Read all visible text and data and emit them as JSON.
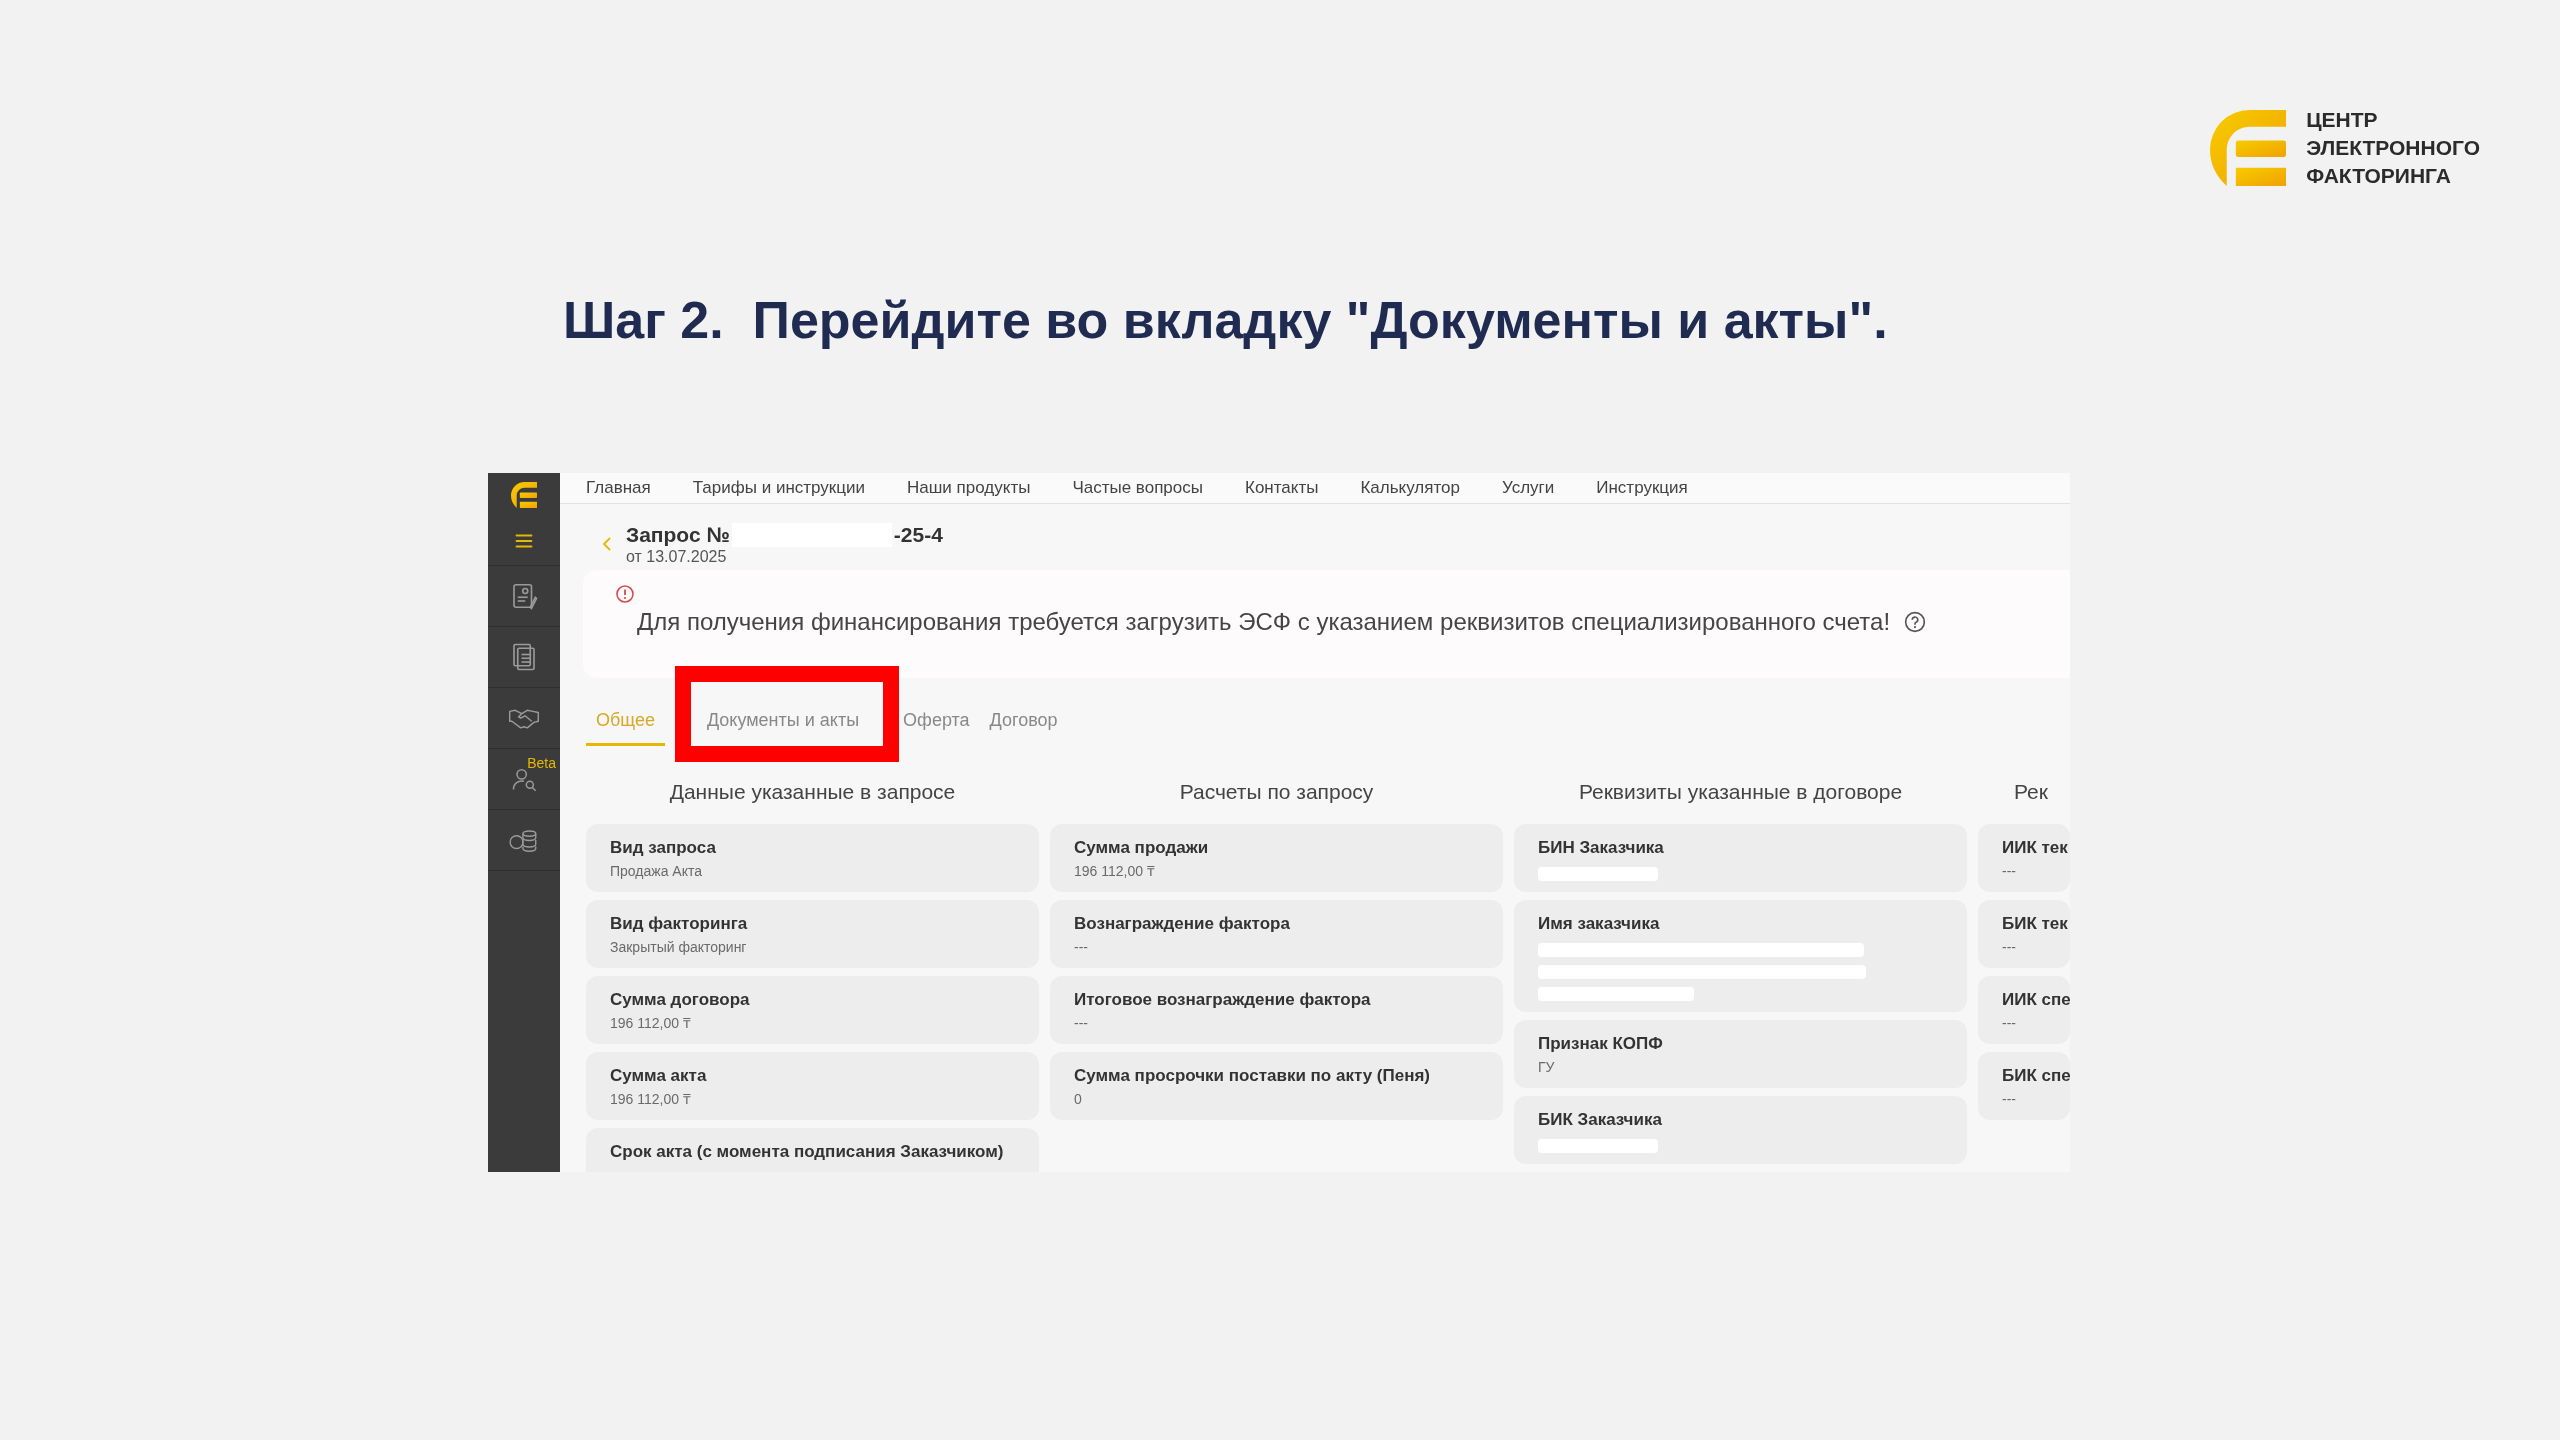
{
  "brand": {
    "lines": [
      "ЦЕНТР",
      "ЭЛЕКТРОННОГО",
      "ФАКТОРИНГА"
    ]
  },
  "heading": "Шаг 2.  Перейдите во вкладку \"Документы и акты\".",
  "app": {
    "sidebar": {
      "items": [
        {
          "kind": "logo"
        },
        {
          "kind": "menu"
        },
        {
          "kind": "document"
        },
        {
          "kind": "pages"
        },
        {
          "kind": "handshake"
        },
        {
          "kind": "person-search",
          "badge": "Beta"
        },
        {
          "kind": "coins"
        }
      ]
    },
    "nav": [
      "Главная",
      "Тарифы и инструкции",
      "Наши продукты",
      "Частые вопросы",
      "Контакты",
      "Калькулятор",
      "Услуги",
      "Инструкция"
    ],
    "request": {
      "title_prefix": "Запрос №",
      "number_redacted": true,
      "title_suffix": "-25-4",
      "date": "от 13.07.2025"
    },
    "alert": {
      "text": "Для получения финансирования требуется загрузить ЭСФ с указанием реквизитов специализированного счета!"
    },
    "tabs": [
      {
        "label": "Общее",
        "selected": true,
        "highlighted": false
      },
      {
        "label": "Документы и акты",
        "selected": false,
        "highlighted": true
      },
      {
        "label": "Оферта",
        "selected": false,
        "highlighted": false
      },
      {
        "label": "Договор",
        "selected": false,
        "highlighted": false
      }
    ],
    "columns": [
      {
        "title": "Данные указанные в запросе",
        "fields": [
          {
            "kind": "text",
            "label": "Вид запроса",
            "value": "Продажа Акта"
          },
          {
            "kind": "text",
            "label": "Вид факторинга",
            "value": "Закрытый факторинг"
          },
          {
            "kind": "text",
            "label": "Сумма договора",
            "value": "196 112,00 ₸"
          },
          {
            "kind": "text",
            "label": "Сумма акта",
            "value": "196 112,00 ₸"
          },
          {
            "kind": "text",
            "label": "Срок акта (с момента подписания Заказчиком)"
          }
        ]
      },
      {
        "title": "Расчеты по запросу",
        "fields": [
          {
            "kind": "text",
            "label": "Сумма продажи",
            "value": "196 112,00 ₸"
          },
          {
            "kind": "text",
            "label": "Вознаграждение фактора",
            "value": "---"
          },
          {
            "kind": "text",
            "label": "Итоговое вознаграждение фактора",
            "value": "---"
          },
          {
            "kind": "text",
            "label": "Сумма просрочки поставки по акту (Пеня)",
            "value": "0"
          }
        ]
      },
      {
        "title": "Реквизиты указанные в договоре",
        "fields": [
          {
            "kind": "redacted",
            "label": "БИН Заказчика"
          },
          {
            "kind": "redacted-block",
            "label": "Имя заказчика"
          },
          {
            "kind": "text",
            "label": "Признак КОПФ",
            "value": "ГУ"
          },
          {
            "kind": "redacted",
            "label": "БИК Заказчика"
          }
        ]
      },
      {
        "title": "Рек",
        "fields": [
          {
            "kind": "text",
            "label": "ИИК тек",
            "value": "---"
          },
          {
            "kind": "text",
            "label": "БИК тек",
            "value": "---"
          },
          {
            "kind": "text",
            "label": "ИИК спе",
            "value": "---"
          },
          {
            "kind": "text",
            "label": "БИК спе",
            "value": "---"
          }
        ]
      }
    ]
  }
}
